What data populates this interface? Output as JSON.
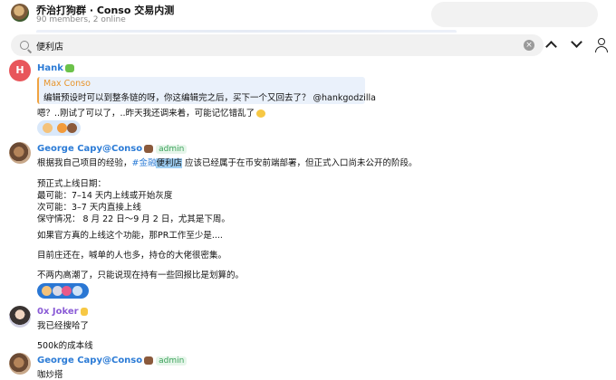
{
  "header": {
    "title": "乔治打狗群 · Conso 交易内测",
    "subtitle": "90 members, 2 online"
  },
  "search": {
    "value": "便利店"
  },
  "icons": {
    "search": "search-icon",
    "clear": "clear-icon",
    "up": "chevron-up-icon",
    "down": "chevron-down-icon",
    "user": "user-icon"
  },
  "messages": {
    "hank": {
      "sender": "Hank",
      "reply_to_name": "Max Conso",
      "reply_to_text": "编辑预设时可以到整条链的呀，你这编辑完之后，买下一个又回去了？ @hankgodzilla",
      "text": "嗯？..刚试了可以了，..昨天我还调来着，可能记忆错乱了"
    },
    "george1": {
      "sender": "George Capy@Conso",
      "badge": "admin",
      "line1_pre": "根据我自己项目的经验，",
      "line1_tag": "#金融",
      "line1_hl": "便利店",
      "line1_post": " 应该已经属于在币安前端部署，但正式入口尚未公开的阶段。",
      "heading": "预正式上线日期：",
      "most_likely": "最可能：7–14 天内上线或开始灰度",
      "second": "次可能：3–7 天内直接上线",
      "conservative": "保守情况： 8 月 22 日～9 月 2 日，尤其是下周。",
      "para2": "如果官方真的上线这个功能，那PR工作至少是....",
      "para3": "目前庄还在，喊单的人也多，持仓的大佬很密集。",
      "para4": "不两内高潮了，只能说现在持有一些回报比是划算的。"
    },
    "joker": {
      "sender": "0x Joker",
      "text1": "我已经搜哈了",
      "text2": "500k的成本线"
    },
    "george2": {
      "sender": "George Capy@Conso",
      "badge": "admin",
      "text": "咖炒搭"
    }
  },
  "colors": {
    "hank_name": "#2b7bd6",
    "george_name": "#2b7bd6",
    "joker_name": "#8a5bd6",
    "quote_name": "#e8952c",
    "highlight": "#9fd0f5",
    "admin": "#3aa15a"
  }
}
